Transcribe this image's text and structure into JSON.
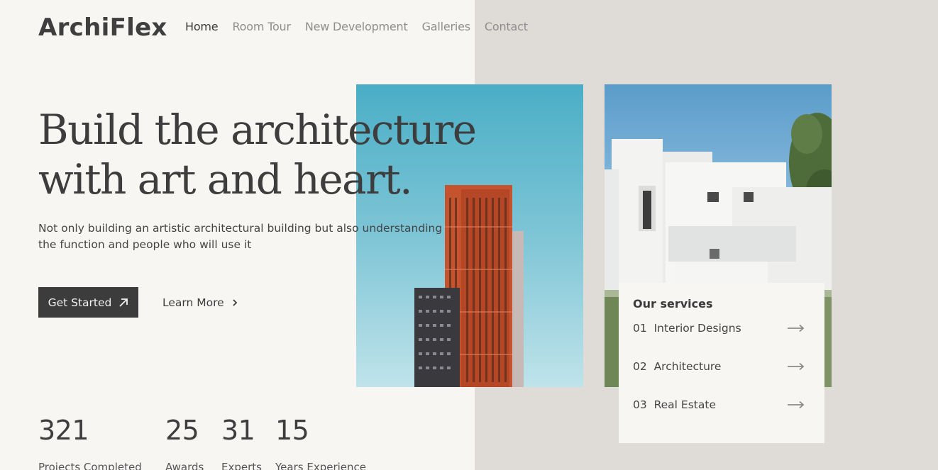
{
  "brand": {
    "name": "ArchiFlex"
  },
  "nav": {
    "items": [
      {
        "label": "Home",
        "active": true
      },
      {
        "label": "Room Tour",
        "active": false
      },
      {
        "label": "New Development",
        "active": false
      },
      {
        "label": "Galleries",
        "active": false
      },
      {
        "label": "Contact",
        "active": false
      }
    ]
  },
  "hero": {
    "title_line1": "Build the architecture",
    "title_line2": "with art and heart.",
    "subtitle_line1": "Not only building an artistic architectural building but also understanding",
    "subtitle_line2": "the function and people who will use it",
    "primary_button": "Get Started",
    "secondary_button": "Learn More"
  },
  "stats": [
    {
      "value": "321",
      "label": "Projects Completed"
    },
    {
      "value": "25",
      "label": "Awards"
    },
    {
      "value": "31",
      "label": "Experts"
    },
    {
      "value": "15",
      "label": "Years Experience"
    }
  ],
  "services": {
    "title": "Our services",
    "items": [
      {
        "label": "01  Interior Designs"
      },
      {
        "label": "02  Architecture"
      },
      {
        "label": "03  Real Estate"
      }
    ]
  },
  "icons": {
    "primary_button_icon": "arrow-up-right-icon",
    "secondary_button_icon": "chevron-right-icon",
    "service_arrow": "arrow-right-icon"
  },
  "colors": {
    "background_left": "#f8f6f3",
    "background_right": "#dfdbd7",
    "primary_button": "#3c3c3c",
    "text_dark": "#3b3b3b",
    "nav_inactive": "#8e8e8e"
  }
}
